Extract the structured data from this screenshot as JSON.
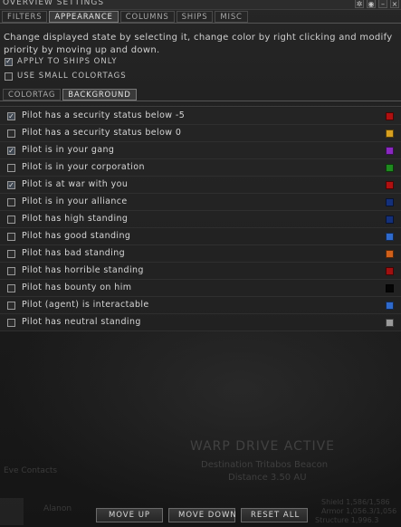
{
  "window": {
    "title": "OVERVIEW SETTINGS"
  },
  "tabs_top": [
    "FILTERS",
    "APPEARANCE",
    "COLUMNS",
    "SHIPS",
    "MISC"
  ],
  "tabs_top_active": "APPEARANCE",
  "tabs_sub": [
    "COLORTAG",
    "BACKGROUND"
  ],
  "tabs_sub_active": "BACKGROUND",
  "description": "Change displayed state by selecting it, change color by right clicking and modify priority by moving up and down.",
  "options": [
    {
      "label": "APPLY TO SHIPS ONLY",
      "checked": true
    },
    {
      "label": "USE SMALL COLORTAGS",
      "checked": false
    }
  ],
  "states": [
    {
      "label": "Pilot has a security status below -5",
      "checked": true,
      "color": "#b01010"
    },
    {
      "label": "Pilot has a security status below 0",
      "checked": false,
      "color": "#d8a020"
    },
    {
      "label": "Pilot is in your gang",
      "checked": true,
      "color": "#8a28c0"
    },
    {
      "label": "Pilot is in your corporation",
      "checked": false,
      "color": "#1f8a1f"
    },
    {
      "label": "Pilot is at war with you",
      "checked": true,
      "color": "#b01010"
    },
    {
      "label": "Pilot is in your alliance",
      "checked": false,
      "color": "#14307a"
    },
    {
      "label": "Pilot has high standing",
      "checked": false,
      "color": "#14307a"
    },
    {
      "label": "Pilot has good standing",
      "checked": false,
      "color": "#2f6acc"
    },
    {
      "label": "Pilot has bad standing",
      "checked": false,
      "color": "#d0601a"
    },
    {
      "label": "Pilot has horrible standing",
      "checked": false,
      "color": "#a01010"
    },
    {
      "label": "Pilot has bounty on him",
      "checked": false,
      "color": "#050505"
    },
    {
      "label": "Pilot (agent) is interactable",
      "checked": false,
      "color": "#2f6acc"
    },
    {
      "label": "Pilot has neutral standing",
      "checked": false,
      "color": "#9a9a9a"
    }
  ],
  "background_text": {
    "warp": "WARP DRIVE ACTIVE",
    "dest": "Destination Tritabos Beacon",
    "dist": "Distance 3.50 AU",
    "pilot": "Alanon",
    "shield": "Shield 1,586/1,586",
    "armor": "Armor 1,056.3/1,056",
    "structure": "Structure 1,996.3",
    "sidebar_label": "Eve Contacts"
  },
  "buttons": [
    "MOVE UP",
    "MOVE DOWN",
    "RESET ALL"
  ]
}
